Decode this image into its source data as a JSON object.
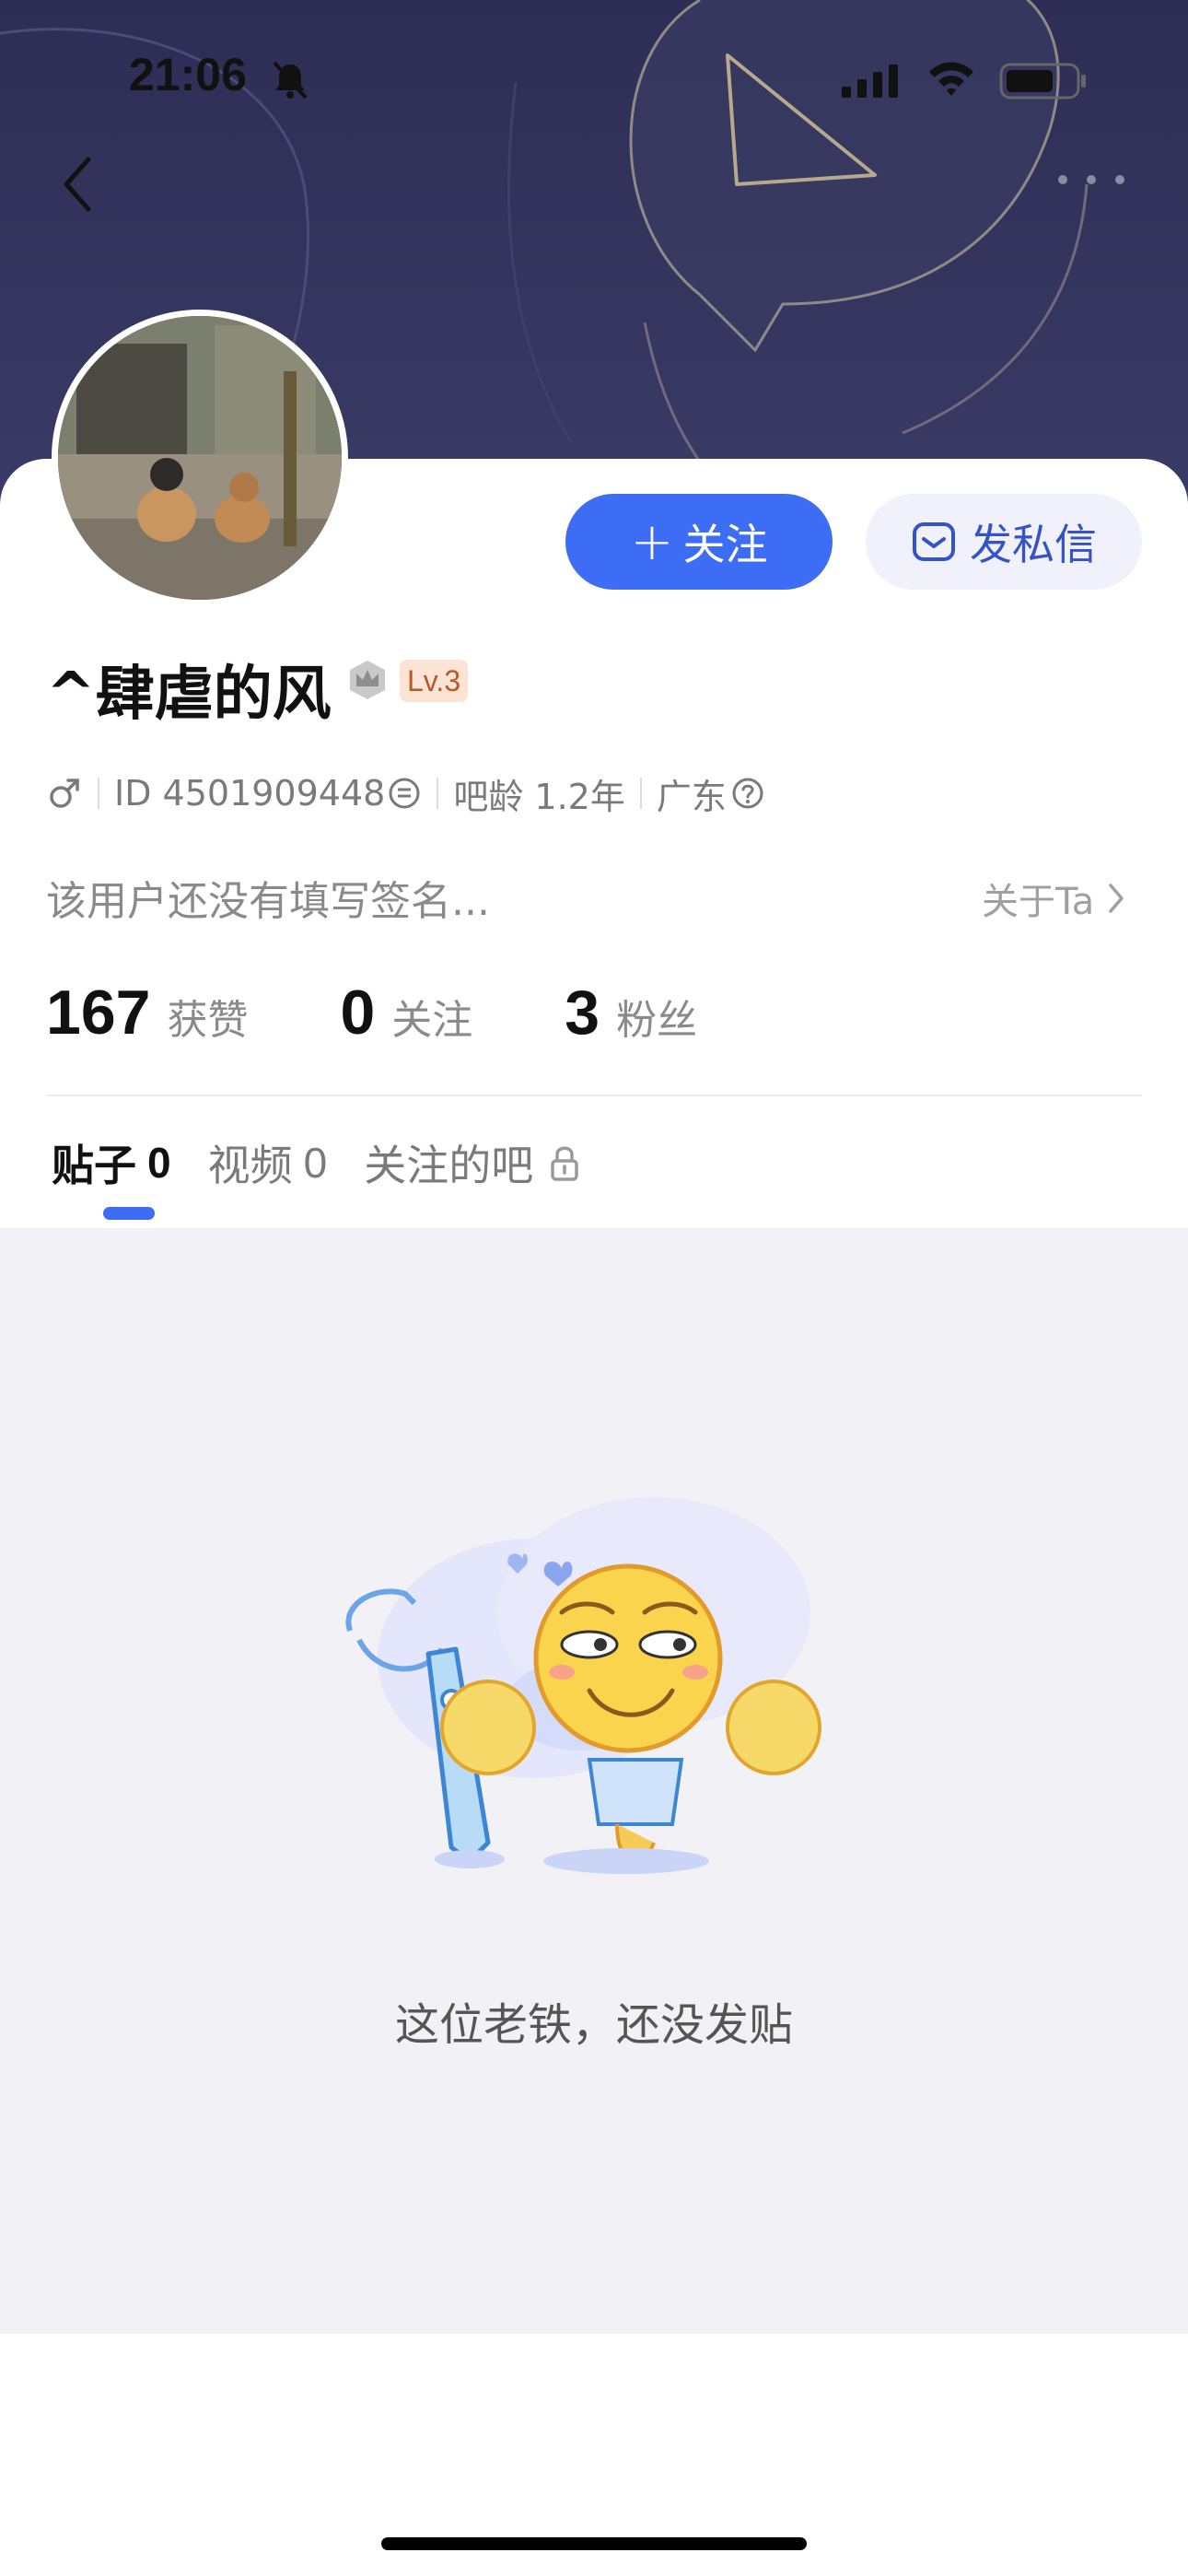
{
  "status_bar": {
    "time": "21:06"
  },
  "profile": {
    "username": "^肆虐的风",
    "level": "Lv.3",
    "id_text": "ID 4501909448",
    "bar_age": "吧龄 1.2年",
    "location": "广东",
    "signature": "该用户还没有填写签名...",
    "about_label": "关于Ta"
  },
  "actions": {
    "follow_plus": "+",
    "follow_label": "关注",
    "dm_label": "发私信"
  },
  "stats": [
    {
      "num": "167",
      "label": "获赞"
    },
    {
      "num": "0",
      "label": "关注"
    },
    {
      "num": "3",
      "label": "粉丝"
    }
  ],
  "tabs": [
    {
      "label": "贴子",
      "count": "0"
    },
    {
      "label": "视频",
      "count": "0"
    },
    {
      "label": "关注的吧"
    }
  ],
  "empty_state": {
    "text": "这位老铁，还没发贴"
  },
  "colors": {
    "accent": "#3d6df5",
    "banner": "#2d2d55",
    "empty_bg": "#f2f2f6"
  }
}
